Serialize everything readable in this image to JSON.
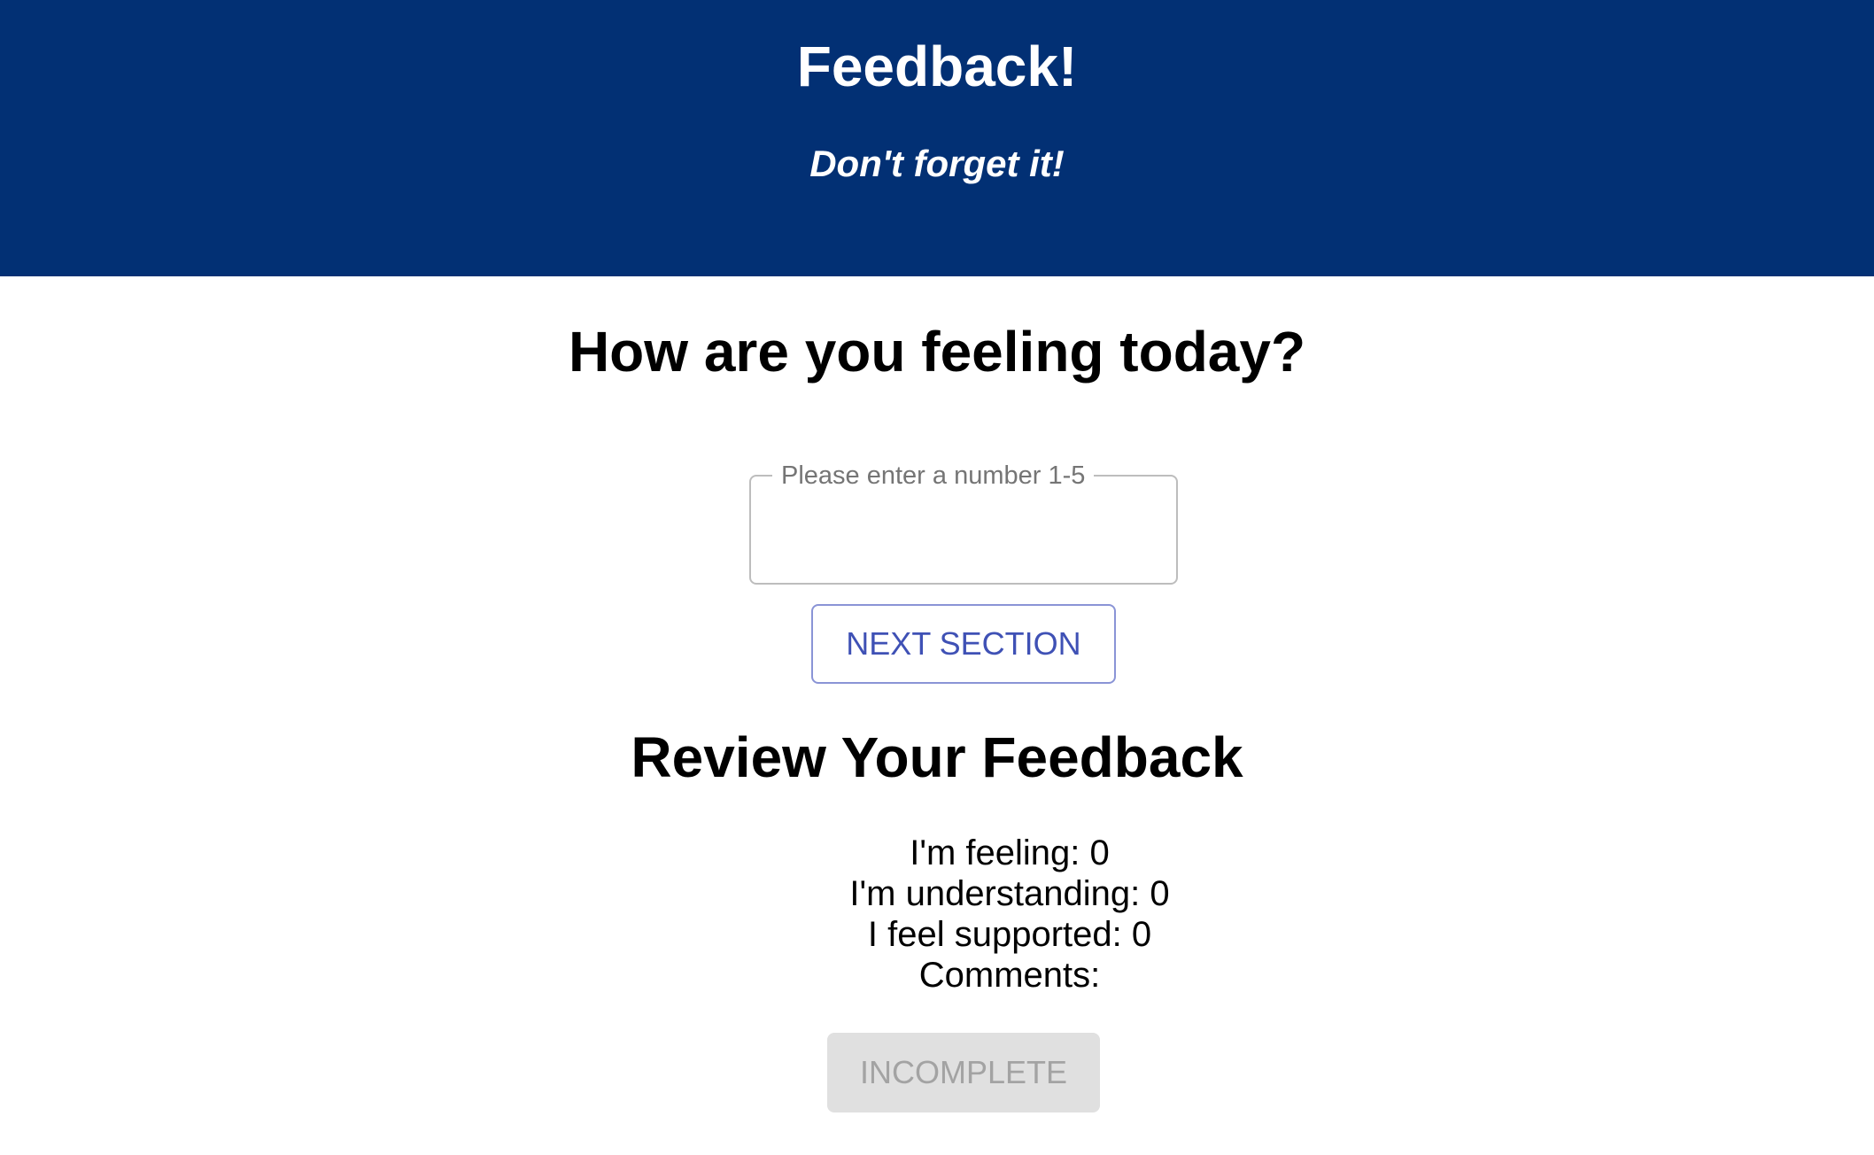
{
  "header": {
    "title": "Feedback!",
    "subtitle": "Don't forget it!",
    "background_color": "#023074"
  },
  "question": {
    "title": "How are you feeling today?",
    "input_label": "Please enter a number 1-5",
    "input_value": ""
  },
  "next_button": {
    "label": "NEXT SECTION",
    "color": "#3f51b5"
  },
  "review": {
    "title": "Review Your Feedback",
    "feeling_label": "I'm feeling: 0",
    "understanding_label": "I'm understanding: 0",
    "supported_label": "I feel supported: 0",
    "comments_label": "Comments:"
  },
  "submit_button": {
    "label": "INCOMPLETE",
    "disabled": true
  }
}
